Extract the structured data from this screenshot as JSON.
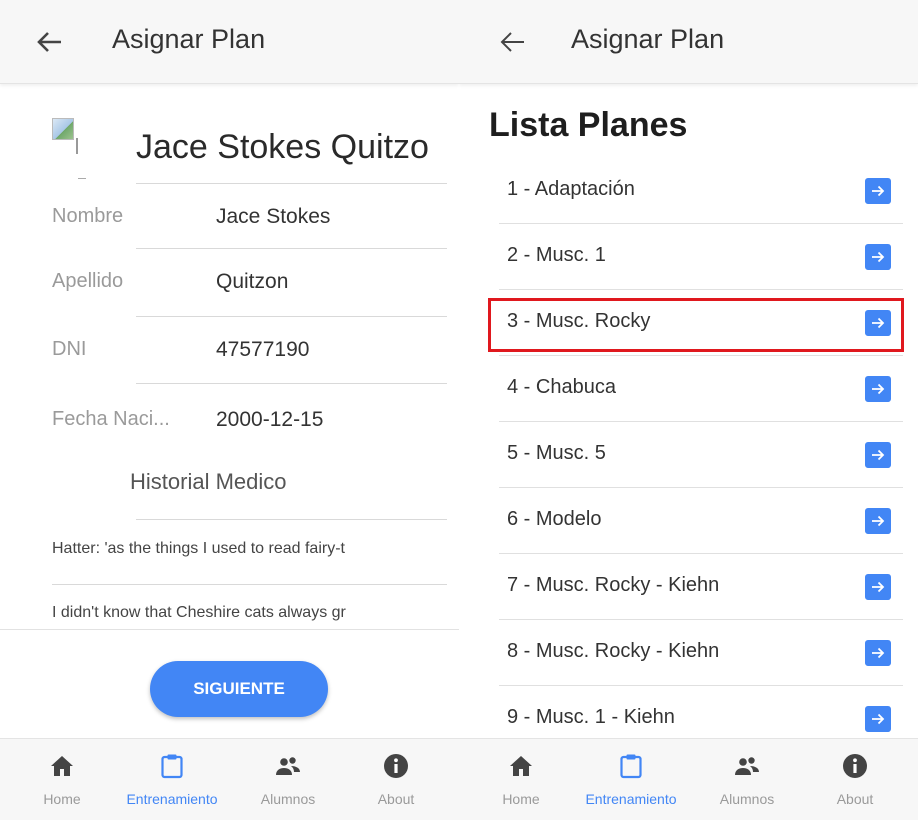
{
  "left_screen": {
    "appbar": {
      "title": "Asignar Plan"
    },
    "student": {
      "header_name": "Jace Stokes Quitzo",
      "fields": [
        {
          "label": "Nombre",
          "value": "Jace Stokes"
        },
        {
          "label": "Apellido",
          "value": "Quitzon"
        },
        {
          "label": "DNI",
          "value": "47577190"
        },
        {
          "label": "Fecha Naci...",
          "value": "2000-12-15"
        }
      ],
      "historial_title": "Historial Medico",
      "historial_items": [
        "Hatter: 'as the things I used to read fairy-t",
        "I didn't know that Cheshire cats always gr"
      ]
    },
    "next_button": "SIGUIENTE"
  },
  "right_screen": {
    "appbar": {
      "title": "Asignar Plan"
    },
    "list_title": "Lista Planes",
    "plans": [
      "1 - Adaptación",
      "2 - Musc. 1",
      "3 - Musc. Rocky",
      "4 - Chabuca",
      "5 - Musc. 5",
      "6 - Modelo",
      "7 - Musc. Rocky - Kiehn",
      "8 - Musc. Rocky - Kiehn",
      "9 - Musc. 1 - Kiehn"
    ],
    "highlighted_plan_index": 2
  },
  "bottom_nav": {
    "items": [
      {
        "label": "Home",
        "icon": "home-icon"
      },
      {
        "label": "Entrenamiento",
        "icon": "clipboard-icon"
      },
      {
        "label": "Alumnos",
        "icon": "people-icon"
      },
      {
        "label": "About",
        "icon": "info-icon"
      }
    ],
    "active_index": 1
  },
  "colors": {
    "accent": "#4286f5",
    "highlight_border": "#e0181e",
    "bar_background": "#f7f7f7"
  }
}
